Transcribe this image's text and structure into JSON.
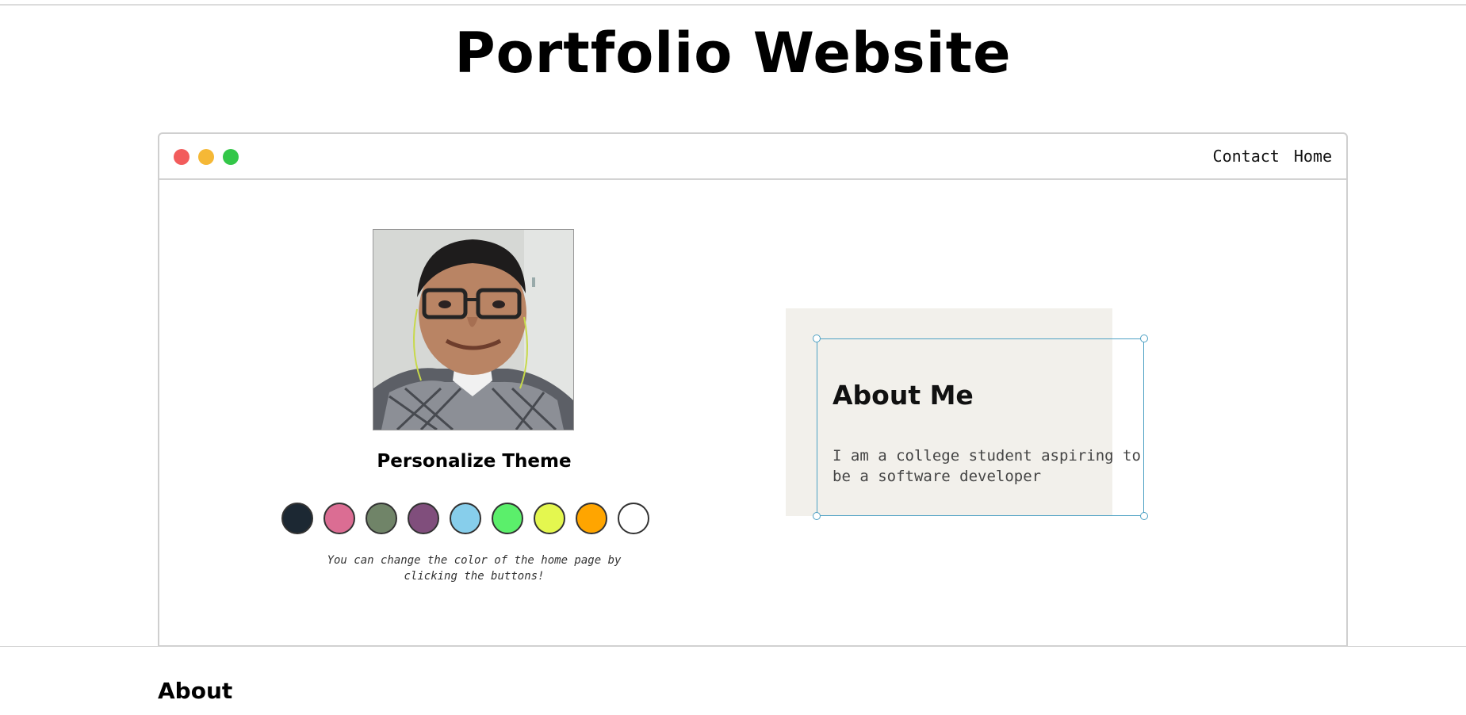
{
  "page": {
    "title": "Portfolio Website"
  },
  "window": {
    "nav": {
      "contact_label": "Contact",
      "home_label": "Home"
    }
  },
  "profile": {
    "photo_alt": "Profile photo"
  },
  "theme": {
    "title": "Personalize Theme",
    "note": "You can change the color of the home page by clicking the buttons!",
    "colors": [
      "#1c2833",
      "#db6d93",
      "#708468",
      "#804e7c",
      "#87ceeb",
      "#5bef6b",
      "#e4f74f",
      "#ffa500",
      "#ffffff"
    ]
  },
  "about_card": {
    "heading": "About Me",
    "text": "I am a college student aspiring to be a software developer"
  },
  "section": {
    "heading": "About"
  }
}
